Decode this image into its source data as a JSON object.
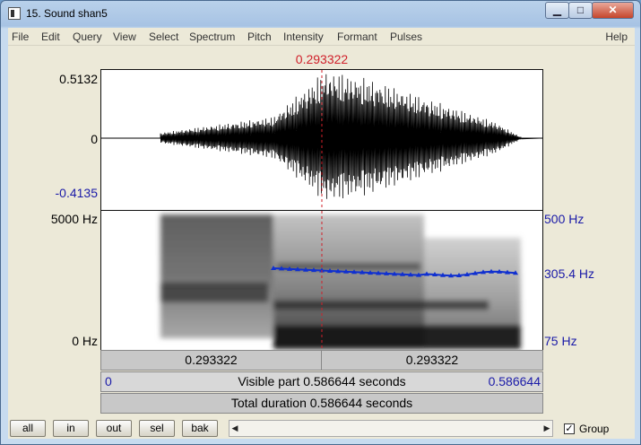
{
  "window": {
    "title": "15. Sound shan5",
    "min_label": "▁",
    "max_label": "□",
    "close_label": "✕"
  },
  "menu": [
    "File",
    "Edit",
    "Query",
    "View",
    "Select",
    "Spectrum",
    "Pitch",
    "Intensity",
    "Formant",
    "Pulses"
  ],
  "menu_help": "Help",
  "cursor": {
    "time": "0.293322",
    "fraction": 0.5
  },
  "waveform": {
    "ymax": "0.5132",
    "yzero": "0",
    "ymin": "-0.4135"
  },
  "spectrogram": {
    "fmax": "5000 Hz",
    "fmin": "0 Hz"
  },
  "pitch": {
    "top": "500 Hz",
    "current": "305.4 Hz",
    "bottom": "75 Hz",
    "color": "#1030d0"
  },
  "time_bar": {
    "left": "0.293322",
    "right": "0.293322"
  },
  "visible_bar": {
    "start": "0",
    "label": "Visible part 0.586644 seconds",
    "end": "0.586644"
  },
  "total_bar": {
    "label": "Total duration 0.586644 seconds"
  },
  "buttons": {
    "all": "all",
    "in": "in",
    "out": "out",
    "sel": "sel",
    "bak": "bak"
  },
  "scroll": {
    "left_arrow": "◀",
    "right_arrow": "▶"
  },
  "group": {
    "checked": true,
    "label": "Group",
    "check_mark": "✓"
  }
}
